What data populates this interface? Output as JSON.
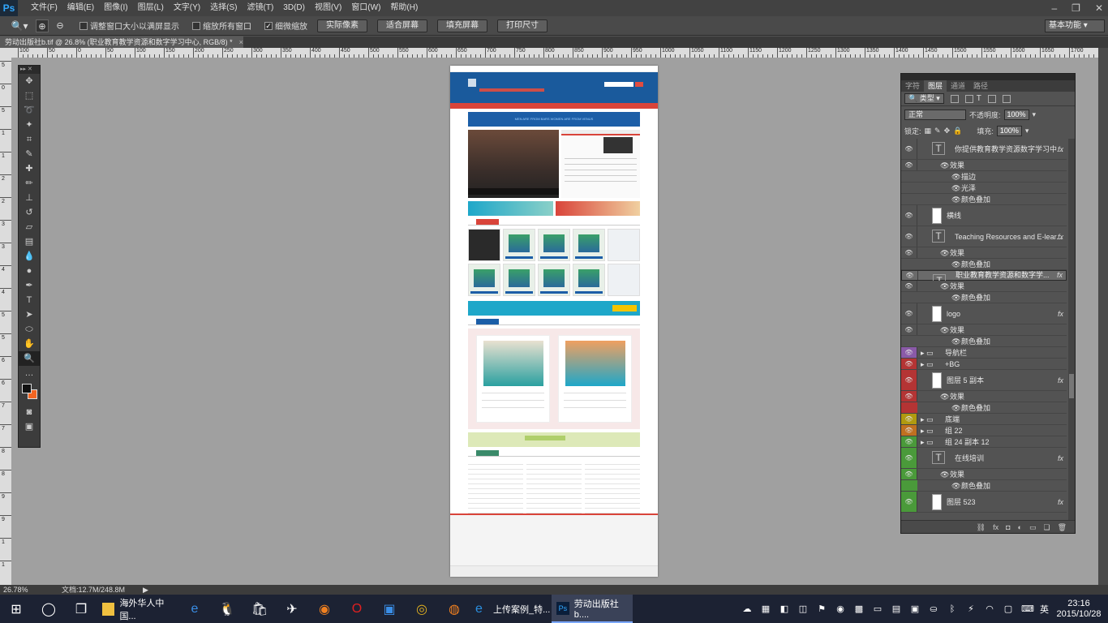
{
  "menubar": {
    "logo": "Ps",
    "menus": [
      "文件(F)",
      "编辑(E)",
      "图像(I)",
      "图层(L)",
      "文字(Y)",
      "选择(S)",
      "滤镜(T)",
      "3D(D)",
      "视图(V)",
      "窗口(W)",
      "帮助(H)"
    ]
  },
  "options": {
    "resize_windows": "调整窗口大小以满屏显示",
    "zoom_all": "缩放所有窗口",
    "scrubby_zoom": "细微缩放",
    "actual_pixels": "实际像素",
    "fit_screen": "适合屏幕",
    "fill_screen": "填充屏幕",
    "print_size": "打印尺寸",
    "workspace": "基本功能"
  },
  "document": {
    "tab_title": "劳动出版社b.tif @ 26.8% (职业教育教学资源和数字学习中心, RGB/8) *",
    "close": "×"
  },
  "ruler": {
    "h_labels": [
      "100",
      "50",
      "0",
      "50",
      "100",
      "150",
      "200",
      "250",
      "300",
      "350",
      "400",
      "450",
      "500",
      "550",
      "600",
      "650",
      "700",
      "750",
      "800",
      "850",
      "900",
      "950",
      "1000",
      "1050",
      "1100",
      "1150",
      "1200",
      "1250",
      "1300",
      "1350",
      "1400",
      "1450",
      "1500",
      "1550",
      "1600",
      "1650",
      "1700",
      "1750"
    ],
    "v_labels": [
      "5",
      "0",
      "5",
      "1",
      "1",
      "2",
      "2",
      "3",
      "3",
      "4",
      "4",
      "5",
      "5",
      "6",
      "6",
      "7",
      "7",
      "8",
      "8",
      "9",
      "9",
      "1",
      "1"
    ]
  },
  "webpage": {
    "banner_text": "MEN ARE FROM BARS WOMEN ARE FROM VENUS"
  },
  "layers_panel": {
    "tabs": [
      "字符",
      "图层",
      "通道",
      "路径"
    ],
    "filter_kind": "类型",
    "blend_mode": "正常",
    "opacity_label": "不透明度:",
    "opacity_value": "100%",
    "lock_label": "锁定:",
    "fill_label": "填充:",
    "fill_value": "100%",
    "layers": [
      {
        "name": "你提供教育教学资源数字学习中...",
        "kind": "text",
        "fx": true
      },
      {
        "name": "效果",
        "kind": "effect-group"
      },
      {
        "name": "描边",
        "kind": "effect"
      },
      {
        "name": "光泽",
        "kind": "effect"
      },
      {
        "name": "颜色叠加",
        "kind": "effect"
      },
      {
        "name": "横线",
        "kind": "pixel"
      },
      {
        "name": "Teaching Resources and E-lear...",
        "kind": "text",
        "fx": true
      },
      {
        "name": "效果",
        "kind": "effect-group"
      },
      {
        "name": "颜色叠加",
        "kind": "effect"
      },
      {
        "name": "职业教育教学资源和数字学...",
        "kind": "text",
        "fx": true,
        "selected": true
      },
      {
        "name": "效果",
        "kind": "effect-group"
      },
      {
        "name": "颜色叠加",
        "kind": "effect"
      },
      {
        "name": "logo",
        "kind": "pixel",
        "fx": true
      },
      {
        "name": "效果",
        "kind": "effect-group"
      },
      {
        "name": "颜色叠加",
        "kind": "effect"
      },
      {
        "name": "导航栏",
        "kind": "group",
        "tag": "#8a5aa8"
      },
      {
        "name": "+BG",
        "kind": "group",
        "tag": "#b43434"
      },
      {
        "name": "图层 5 副本",
        "kind": "pixel",
        "fx": true,
        "tag": "#b43434"
      },
      {
        "name": "效果",
        "kind": "effect-group",
        "tag": "#b43434"
      },
      {
        "name": "颜色叠加",
        "kind": "effect",
        "tag": "#b43434"
      },
      {
        "name": "底端",
        "kind": "group",
        "tag": "#b09a10"
      },
      {
        "name": "组 22",
        "kind": "group",
        "tag": "#c07020"
      },
      {
        "name": "组 24 副本 12",
        "kind": "group",
        "tag": "#4a9a3a"
      },
      {
        "name": "在线培训",
        "kind": "text",
        "fx": true,
        "tag": "#4a9a3a"
      },
      {
        "name": "效果",
        "kind": "effect-group",
        "tag": "#4a9a3a"
      },
      {
        "name": "颜色叠加",
        "kind": "effect",
        "tag": "#4a9a3a"
      },
      {
        "name": "图层 523",
        "kind": "pixel",
        "fx": true,
        "tag": "#4a9a3a"
      }
    ],
    "bottom_icons": [
      "link-icon",
      "fx-icon",
      "mask-icon",
      "adjustment-icon",
      "folder-icon",
      "new-layer-icon",
      "trash-icon"
    ]
  },
  "status": {
    "zoom": "26.78%",
    "doc_size": "文档:12.7M/248.8M",
    "arrow": "▶"
  },
  "taskbar": {
    "apps": [
      {
        "label": "海外华人中国...",
        "icon": "folder-icon",
        "color": "#f0c040"
      },
      {
        "label": "上传案例_特...",
        "icon": "ie-icon",
        "color": "#2a8fe0"
      },
      {
        "label": "劳动出版社b....",
        "icon": "photoshop-icon",
        "color": "#31a8ff",
        "active": true
      }
    ],
    "lang": "英",
    "time": "23:16",
    "date": "2015/10/28"
  }
}
